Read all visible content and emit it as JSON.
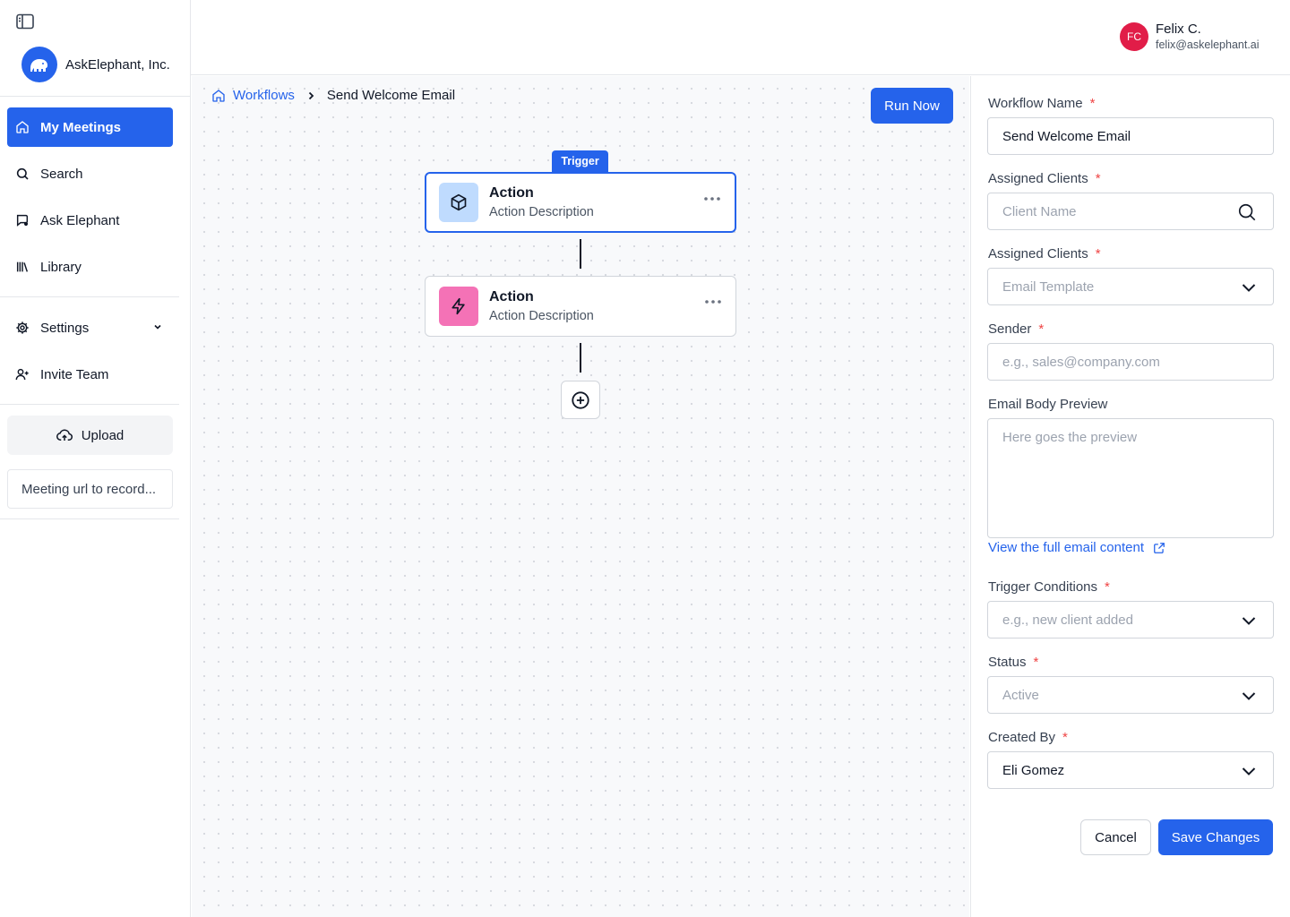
{
  "org": {
    "name": "AskElephant, Inc."
  },
  "sidebar": {
    "items": [
      {
        "label": "My Meetings",
        "icon": "home-icon",
        "active": true
      },
      {
        "label": "Search",
        "icon": "search-icon"
      },
      {
        "label": "Ask Elephant",
        "icon": "chat-icon"
      },
      {
        "label": "Library",
        "icon": "library-icon"
      },
      {
        "label": "Settings",
        "icon": "gear-icon"
      },
      {
        "label": "Invite Team",
        "icon": "user-plus-icon"
      }
    ],
    "upload_label": "Upload",
    "meeting_url_placeholder": "Meeting url to record..."
  },
  "user": {
    "initials": "FC",
    "name": "Felix C.",
    "email": "felix@askelephant.ai"
  },
  "breadcrumb": {
    "parent": "Workflows",
    "current": "Send Welcome Email"
  },
  "toolbar": {
    "run_label": "Run Now"
  },
  "workflow": {
    "trigger_label": "Trigger",
    "nodes": [
      {
        "title": "Action",
        "description": "Action Description",
        "icon": "box-icon",
        "color": "#bfdbfe"
      },
      {
        "title": "Action",
        "description": "Action Description",
        "icon": "lightning-icon",
        "color": "#f472b6"
      }
    ]
  },
  "form": {
    "workflow_name": {
      "label": "Workflow Name",
      "value": "Send Welcome Email"
    },
    "assigned_clients": {
      "label": "Assigned Clients",
      "placeholder": "Client Name"
    },
    "email_template": {
      "label": "Assigned Clients",
      "placeholder": "Email Template"
    },
    "sender": {
      "label": "Sender",
      "placeholder": "e.g., sales@company.com"
    },
    "email_body": {
      "label": "Email Body Preview",
      "placeholder": "Here goes the preview"
    },
    "view_full_link": "View the full email content",
    "trigger_conditions": {
      "label": "Trigger Conditions",
      "placeholder": "e.g., new client added"
    },
    "status": {
      "label": "Status",
      "placeholder": "Active"
    },
    "created_by": {
      "label": "Created By",
      "value": "Eli Gomez"
    },
    "required_mark": "*",
    "cancel_label": "Cancel",
    "save_label": "Save Changes"
  },
  "colors": {
    "primary": "#2563eb",
    "avatar": "#e11d48",
    "required": "#ef4444"
  }
}
